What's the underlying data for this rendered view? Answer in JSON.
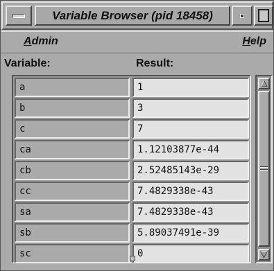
{
  "window": {
    "title": "Variable Browser (pid 18458)"
  },
  "menubar": {
    "admin": {
      "mnemonic": "A",
      "rest": "dmin"
    },
    "help": {
      "mnemonic": "H",
      "rest": "elp"
    }
  },
  "headers": {
    "variable": "Variable:",
    "result": "Result:"
  },
  "rows": [
    {
      "variable": "a",
      "result": "1"
    },
    {
      "variable": "b",
      "result": "3"
    },
    {
      "variable": "c",
      "result": "7"
    },
    {
      "variable": "ca",
      "result": "1.12103877e-44"
    },
    {
      "variable": "cb",
      "result": "2.52485143e-29"
    },
    {
      "variable": "cc",
      "result": "7.4829338e-43"
    },
    {
      "variable": "sa",
      "result": "7.4829338e-43"
    },
    {
      "variable": "sb",
      "result": "5.89037491e-39"
    },
    {
      "variable": "sc",
      "result": "0"
    }
  ]
}
